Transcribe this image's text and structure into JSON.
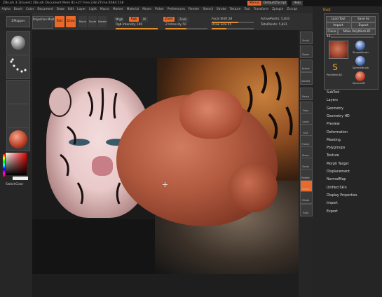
{
  "titlebar": {
    "text": "ZBrush 3.1[Guest]   ZBrush Document   Mem 81+27 Free:238 ZTime:4684.538",
    "buttons": [
      "Menus",
      "DefaultZScript",
      "Help"
    ]
  },
  "menubar": [
    "Alpha",
    "Brush",
    "Color",
    "Document",
    "Draw",
    "Edit",
    "Layer",
    "Light",
    "Macro",
    "Marker",
    "Material",
    "Movie",
    "Picker",
    "Preferences",
    "Render",
    "Stencil",
    "Stroke",
    "Texture",
    "Tool",
    "Transform",
    "Zplugin",
    "Zscript"
  ],
  "toolbar": {
    "projection_master": "Projection Master",
    "edit": "Edit",
    "draw": "Draw",
    "move": "Move",
    "scale": "Scale",
    "rotate": "Rotate",
    "mrgb": "Mrgb",
    "rgb": "Rgb",
    "m": "M",
    "rgb_intensity": "Rgb Intensity 100",
    "zadd": "Zadd",
    "zsub": "Zsub",
    "z_intensity": "Z Intensity 50",
    "focal_shift": "Focal Shift 28",
    "draw_size": "Draw Size 45",
    "active_points": "ActivePoints: 5,831",
    "total_points": "TotalPoints: 5,831"
  },
  "leftshelf": {
    "zmapper": "ZMapper",
    "switch_color": "SwitchColor"
  },
  "rightshelf": [
    "Scroll",
    "Zoom",
    "Actual",
    "AAHalf",
    "Persp",
    "Floor",
    "Local",
    "XYZ",
    "Frame",
    "Move",
    "Scale",
    "Rotate",
    "Transp",
    "Ghost",
    "Solo"
  ],
  "tool_panel": {
    "title": "Tool",
    "buttons": [
      "Load Tool",
      "Save As",
      "Import",
      "Export",
      "Clone",
      "Make PolyMesh3D"
    ],
    "count": "48",
    "thumbs": [
      "PolyMesh3D",
      "SimpleBrush",
      "SphereBrush",
      "Sphere3D"
    ]
  },
  "tool_menu": [
    "SubTool",
    "Layers",
    "Geometry",
    "Geometry HD",
    "Preview",
    "Deformation",
    "Masking",
    "Polygroups",
    "Texture",
    "Morph Target",
    "Displacement",
    "NormalMap",
    "Unified Skin",
    "Display Properties",
    "Import",
    "Export"
  ],
  "colors": {
    "accent": "#e8692a",
    "tool_title": "#e08a2a"
  }
}
